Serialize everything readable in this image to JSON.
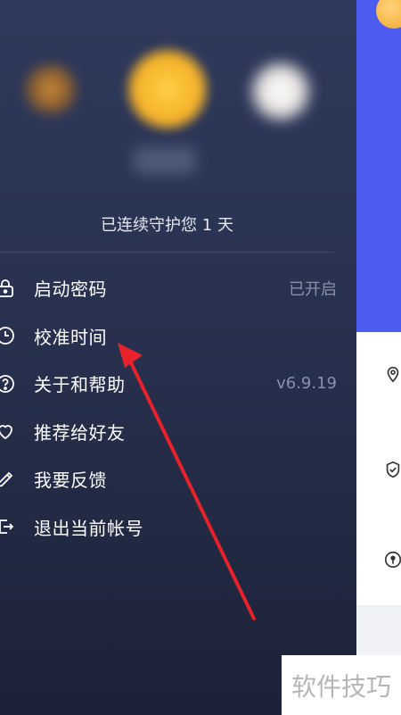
{
  "drawer": {
    "guard_text": "已连续守护您 1 天",
    "menu": [
      {
        "icon": "lock-icon",
        "label": "启动密码",
        "value": "已开启"
      },
      {
        "icon": "clock-icon",
        "label": "校准时间",
        "value": ""
      },
      {
        "icon": "help-icon",
        "label": "关于和帮助",
        "value": "v6.9.19"
      },
      {
        "icon": "heart-icon",
        "label": "推荐给好友",
        "value": ""
      },
      {
        "icon": "pencil-icon",
        "label": "我要反馈",
        "value": ""
      },
      {
        "icon": "logout-icon",
        "label": "退出当前帐号",
        "value": ""
      }
    ]
  },
  "main": {
    "header_color": "#4f5cf0",
    "peek_icons": [
      "location-icon",
      "shield-check-icon",
      "key-icon"
    ]
  },
  "annotation": {
    "arrow_color": "#e8222b"
  },
  "watermark": "软件技巧"
}
